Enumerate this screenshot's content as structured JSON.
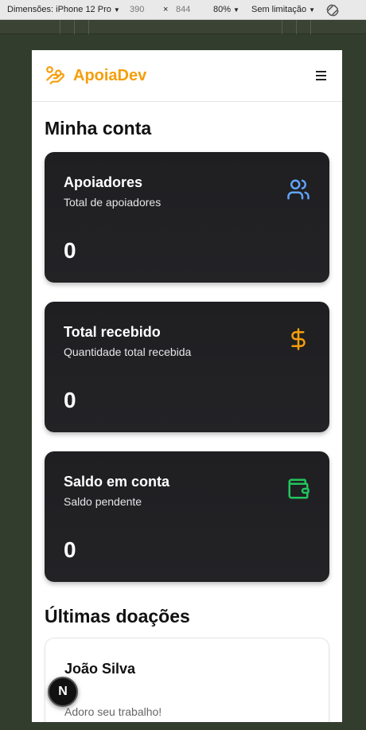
{
  "devtools": {
    "device_label": "Dimensões: iPhone 12 Pro",
    "width": "390",
    "times": "×",
    "height": "844",
    "zoom": "80%",
    "throttle": "Sem limitação"
  },
  "header": {
    "brand": "ApoiaDev",
    "brand_color": "#f59e0b",
    "logo_icon": "hand-coins-icon",
    "menu_icon": "hamburger-menu-icon"
  },
  "page_title": "Minha conta",
  "cards": [
    {
      "title": "Apoiadores",
      "subtitle": "Total de apoiadores",
      "value": "0",
      "icon": "users-icon",
      "icon_color": "#60a5fa"
    },
    {
      "title": "Total recebido",
      "subtitle": "Quantidade total recebida",
      "value": "0",
      "icon": "dollar-sign-icon",
      "icon_color": "#f59e0b"
    },
    {
      "title": "Saldo em conta",
      "subtitle": "Saldo pendente",
      "value": "0",
      "icon": "wallet-icon",
      "icon_color": "#22c55e"
    }
  ],
  "donations_title": "Últimas doações",
  "donations": [
    {
      "name": "João Silva",
      "message": "Adoro seu trabalho!"
    }
  ],
  "next_badge": "N"
}
